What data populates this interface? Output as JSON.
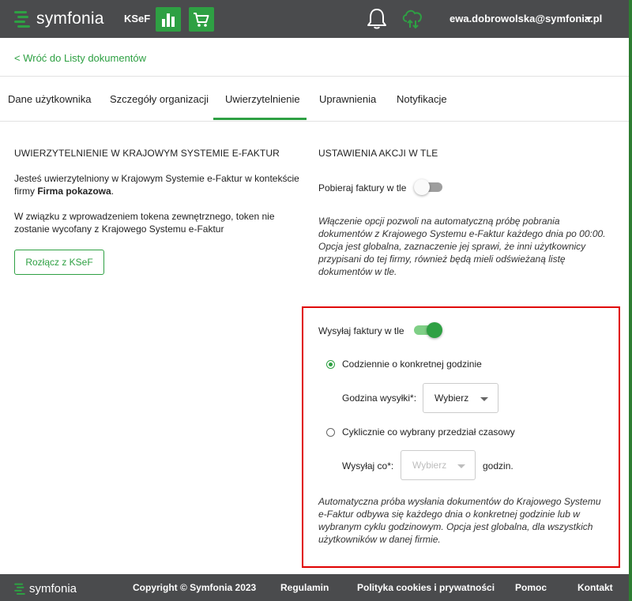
{
  "header": {
    "brand": "symfonia",
    "app_label": "KSeF",
    "user_email": "ewa.dobrowolska@symfonia.pl"
  },
  "nav": {
    "back_link": "< Wróć do Listy dokumentów"
  },
  "tabs": [
    {
      "label": "Dane użytkownika"
    },
    {
      "label": "Szczegóły organizacji"
    },
    {
      "label": "Uwierzytelnienie",
      "active": true
    },
    {
      "label": "Uprawnienia"
    },
    {
      "label": "Notyfikacje"
    }
  ],
  "auth": {
    "title": "UWIERZYTELNIENIE W KRAJOWYM SYSTEMIE E-FAKTUR",
    "line1": "Jesteś uwierzytelniony w Krajowym Systemie e-Faktur w kontekście",
    "line2_prefix": "firmy ",
    "company": "Firma pokazowa",
    "line2_suffix": ".",
    "token_line1": "W związku z wprowadzeniem tokena zewnętrznego, token nie",
    "token_line2": "zostanie wycofany z Krajowego Systemu e-Faktur",
    "disconnect_button": "Rozłącz z KSeF"
  },
  "background": {
    "title": "USTAWIENIA AKCJI W TLE",
    "download_label": "Pobieraj faktury w tle",
    "download_enabled": false,
    "download_desc": [
      "Włączenie opcji pozwoli na automatyczną próbę pobrania",
      "dokumentów z Krajowego Systemu e-Faktur każdego dnia po 00:00.",
      "Opcja jest globalna, zaznaczenie jej sprawi, że inni użytkownicy",
      "przypisani do tej firmy, również będą mieli odświeżaną listę",
      "dokumentów w tle."
    ],
    "send_label": "Wysyłaj faktury w tle",
    "send_enabled": true,
    "option_daily": "Codziennie o konkretnej godzinie",
    "hour_label": "Godzina wysyłki*:",
    "hour_value": "Wybierz",
    "option_cyclic": "Cyklicznie co wybrany przedział czasowy",
    "interval_label": "Wysyłaj co*:",
    "interval_value": "Wybierz",
    "interval_unit": "godzin.",
    "send_desc": [
      "Automatyczna próba wysłania dokumentów do Krajowego Systemu",
      "e-Faktur odbywa się każdego dnia o konkretnej godzinie lub w",
      "wybranym cyklu godzinowym. Opcja jest globalna, dla wszystkich",
      "użytkowników w danej firmie."
    ]
  },
  "footer": {
    "brand": "symfonia",
    "copyright": "Copyright © Symfonia 2023",
    "links": [
      "Regulamin",
      "Polityka cookies i prywatności",
      "Pomoc",
      "Kontakt"
    ]
  },
  "colors": {
    "accent": "#2ea043",
    "header_bg": "#4a4b4d",
    "highlight_border": "#e00000"
  }
}
